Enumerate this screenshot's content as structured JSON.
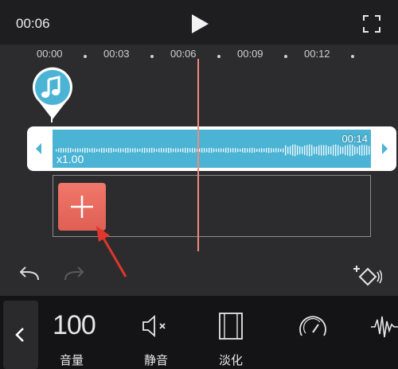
{
  "header": {
    "current_time": "00:06",
    "play_icon": "play-icon",
    "fullscreen_icon": "fullscreen-icon"
  },
  "timeline": {
    "ticks": [
      "00:00",
      "00:03",
      "00:06",
      "00:09",
      "00:12"
    ]
  },
  "audio_clip": {
    "duration": "00:14",
    "speed": "x1.00",
    "color": "#4bb3d4"
  },
  "actions": {
    "undo_icon": "undo-icon",
    "redo_icon": "redo-icon",
    "keyframe_icon": "keyframe-add-icon"
  },
  "toolbar": {
    "volume_value": "100",
    "volume_label": "音量",
    "mute_label": "静音",
    "fade_label": "淡化"
  },
  "colors": {
    "accent": "#e8675b",
    "playhead": "#f08a7e",
    "background": "#2c2c2f"
  }
}
